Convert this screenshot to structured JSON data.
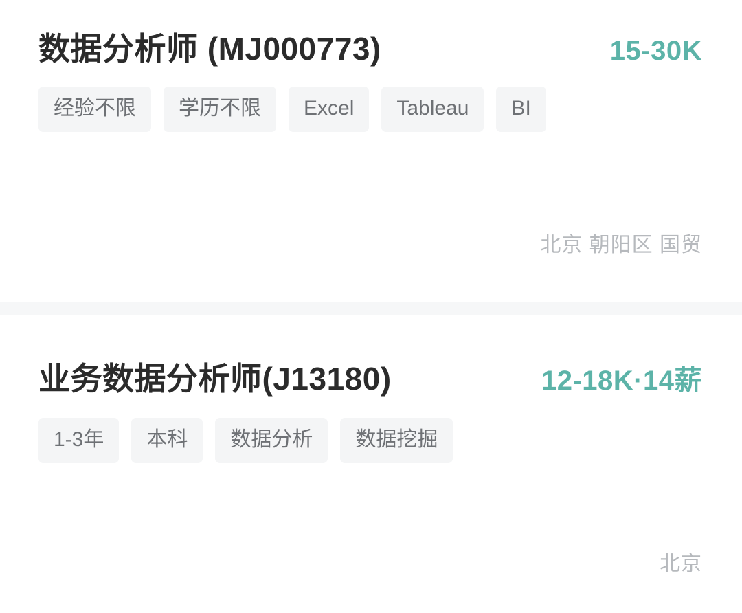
{
  "theme": {
    "page_background": "#ffffff",
    "salary_color": "#5cb3a8",
    "title_color": "#2b2b2b",
    "tag_background": "#f4f5f6",
    "tag_text_color": "#6e7175",
    "location_color": "#b6b9bd",
    "divider_color": "#f6f7f8"
  },
  "jobs": [
    {
      "title": "数据分析师 (MJ000773)",
      "salary": "15-30K",
      "tags": [
        {
          "label": "经验不限"
        },
        {
          "label": "学历不限"
        },
        {
          "label": "Excel"
        },
        {
          "label": "Tableau"
        },
        {
          "label": "BI"
        }
      ],
      "location": "北京 朝阳区 国贸"
    },
    {
      "title": "业务数据分析师(J13180)",
      "salary": "12-18K·14薪",
      "tags": [
        {
          "label": "1-3年"
        },
        {
          "label": "本科"
        },
        {
          "label": "数据分析"
        },
        {
          "label": "数据挖掘"
        }
      ],
      "location": "北京"
    }
  ]
}
